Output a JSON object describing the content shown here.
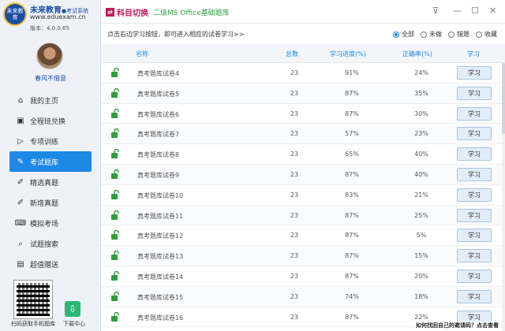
{
  "app": {
    "brand_name": "未来教育",
    "brand_sub": "●考试系统",
    "logo_text": "未来教育",
    "url": "www.eduexam.cn",
    "version": "版本：4.0.0.65",
    "username": "春风不借意"
  },
  "topbar": {
    "switch_label": "科目切换",
    "subject": "二级MS Office基础题库",
    "window_buttons": [
      "collapse-icon",
      "minimize-icon",
      "maximize-icon",
      "close-icon"
    ]
  },
  "nav": [
    {
      "label": "我的主页",
      "icon": "home-icon",
      "active": false
    },
    {
      "label": "全程班兑换",
      "icon": "exchange-icon",
      "active": false
    },
    {
      "label": "专项训练",
      "icon": "play-icon",
      "active": false
    },
    {
      "label": "考试题库",
      "icon": "edit-icon",
      "active": true
    },
    {
      "label": "精选真题",
      "icon": "pen-icon",
      "active": false
    },
    {
      "label": "新增真题",
      "icon": "pen-icon",
      "active": false
    },
    {
      "label": "模拟考场",
      "icon": "keyboard-icon",
      "active": false
    },
    {
      "label": "试题搜索",
      "icon": "search-icon",
      "active": false
    },
    {
      "label": "超值赠送",
      "icon": "gift-icon",
      "active": false
    }
  ],
  "bottom": {
    "qr_label": "扫码获取手机题库",
    "download_label": "下载中心"
  },
  "filter": {
    "hint": "点击右边学习按钮，即可进入相应的试卷学习>>",
    "options": [
      {
        "label": "全部",
        "selected": true
      },
      {
        "label": "未做",
        "selected": false
      },
      {
        "label": "错题",
        "selected": false
      },
      {
        "label": "收藏",
        "selected": false
      }
    ]
  },
  "table": {
    "headers": {
      "name": "名称",
      "total": "总数",
      "progress": "学习进度(%)",
      "rate": "正确率(%)",
      "action": "学习"
    },
    "rows": [
      {
        "name": "真考题库试卷4",
        "total": "23",
        "progress": "91%",
        "rate": "24%",
        "action": "学习"
      },
      {
        "name": "真考题库试卷5",
        "total": "23",
        "progress": "87%",
        "rate": "35%",
        "action": "学习"
      },
      {
        "name": "真考题库试卷6",
        "total": "23",
        "progress": "87%",
        "rate": "30%",
        "action": "学习"
      },
      {
        "name": "真考题库试卷7",
        "total": "23",
        "progress": "57%",
        "rate": "23%",
        "action": "学习"
      },
      {
        "name": "真考题库试卷8",
        "total": "23",
        "progress": "65%",
        "rate": "40%",
        "action": "学习"
      },
      {
        "name": "真考题库试卷9",
        "total": "23",
        "progress": "87%",
        "rate": "40%",
        "action": "学习"
      },
      {
        "name": "真考题库试卷10",
        "total": "23",
        "progress": "83%",
        "rate": "21%",
        "action": "学习"
      },
      {
        "name": "真考题库试卷11",
        "total": "23",
        "progress": "87%",
        "rate": "25%",
        "action": "学习"
      },
      {
        "name": "真考题库试卷12",
        "total": "23",
        "progress": "87%",
        "rate": "5%",
        "action": "学习"
      },
      {
        "name": "真考题库试卷13",
        "total": "23",
        "progress": "87%",
        "rate": "15%",
        "action": "学习"
      },
      {
        "name": "真考题库试卷14",
        "total": "23",
        "progress": "87%",
        "rate": "20%",
        "action": "学习"
      },
      {
        "name": "真考题库试卷15",
        "total": "23",
        "progress": "74%",
        "rate": "18%",
        "action": "学习"
      },
      {
        "name": "真考题库试卷16",
        "total": "23",
        "progress": "87%",
        "rate": "22%",
        "action": "学习"
      }
    ]
  },
  "footer_note": "如何找回自己的邀请码？点击查看",
  "colors": {
    "accent": "#1e88e5",
    "lock": "#2e9e3e",
    "brand": "#1b4fa3",
    "switch": "#c2185b"
  }
}
